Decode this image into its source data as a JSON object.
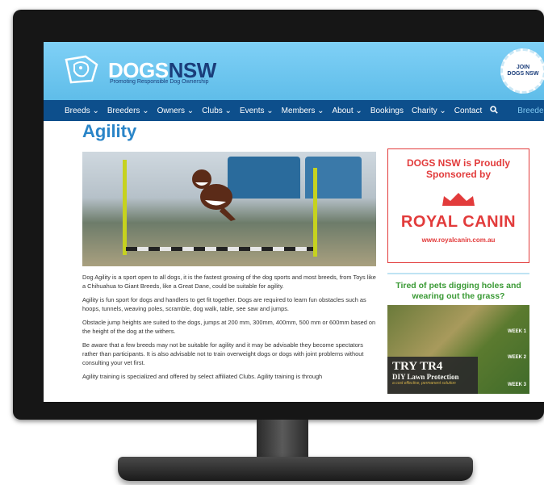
{
  "site": {
    "brand_prefix": "DOGS",
    "brand_suffix": "NSW",
    "tagline": "Promoting Responsible Dog Ownership",
    "join_line1": "JOIN",
    "join_line2": "DOGS NSW"
  },
  "nav": {
    "items": [
      "Breeds ⌄",
      "Breeders ⌄",
      "Owners ⌄",
      "Clubs ⌄",
      "Events ⌄",
      "Members ⌄",
      "About ⌄",
      "Bookings",
      "Charity ⌄",
      "Contact"
    ],
    "search_icon": "search-icon",
    "breeder_login": "Breeder Login"
  },
  "page": {
    "title": "Agility",
    "paragraphs": [
      "Dog Agility is a sport open to all dogs, it is the fastest growing of the dog sports and most breeds, from Toys like a Chihuahua to Giant Breeds, like a Great Dane, could be suitable for agility.",
      "Agility is fun sport for dogs and handlers to get fit together. Dogs are required to learn fun obstacles such as hoops, tunnels, weaving poles, scramble, dog walk, table, see saw and jumps.",
      "Obstacle jump heights are suited to the dogs, jumps at 200 mm, 300mm, 400mm, 500 mm or 600mm based on the height of the dog at the withers.",
      "Be aware that a few breeds may not be suitable for agility and it may be advisable they become spectators rather than participants. It is also advisable not to train overweight dogs or dogs with joint problems without consulting your vet first.",
      "Agility training is specialized and offered by select affiliated Clubs. Agility training is through"
    ]
  },
  "ads": {
    "sponsor_title": "DOGS NSW is Proudly Sponsored by",
    "sponsor_brand": "ROYAL CANIN",
    "sponsor_url": "www.royalcanin.com.au",
    "lawn_title": "Tired of pets digging holes and wearing out the grass?",
    "lawn_product": "TRY TR4",
    "lawn_sub": "DIY Lawn Protection",
    "lawn_slogan": "a cost effective, permanent solution",
    "weeks": [
      "WEEK 1",
      "WEEK 2",
      "WEEK 3"
    ]
  },
  "colors": {
    "accent": "#2a85c8",
    "nav_bg": "#0d4f8c",
    "sponsor_red": "#e23b3b",
    "lawn_green": "#3a9a35"
  }
}
